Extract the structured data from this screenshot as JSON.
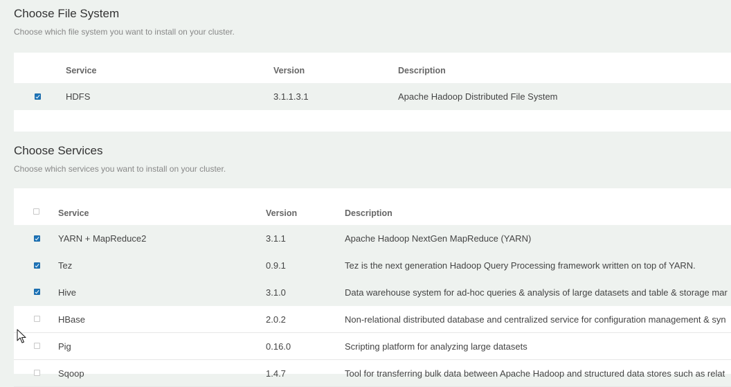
{
  "file_system": {
    "title": "Choose File System",
    "subtitle": "Choose which file system you want to install on your cluster.",
    "columns": {
      "service": "Service",
      "version": "Version",
      "description": "Description"
    },
    "rows": [
      {
        "checked": true,
        "service": "HDFS",
        "version": "3.1.1.3.1",
        "description": "Apache Hadoop Distributed File System"
      }
    ]
  },
  "services": {
    "title": "Choose Services",
    "subtitle": "Choose which services you want to install on your cluster.",
    "columns": {
      "service": "Service",
      "version": "Version",
      "description": "Description"
    },
    "select_all_checked": false,
    "rows": [
      {
        "checked": true,
        "service": "YARN + MapReduce2",
        "version": "3.1.1",
        "description": "Apache Hadoop NextGen MapReduce (YARN)"
      },
      {
        "checked": true,
        "service": "Tez",
        "version": "0.9.1",
        "description": "Tez is the next generation Hadoop Query Processing framework written on top of YARN."
      },
      {
        "checked": true,
        "service": "Hive",
        "version": "3.1.0",
        "description": "Data warehouse system for ad-hoc queries & analysis of large datasets and table & storage mar"
      },
      {
        "checked": false,
        "service": "HBase",
        "version": "2.0.2",
        "description": "Non-relational distributed database and centralized service for configuration management & syn"
      },
      {
        "checked": false,
        "service": "Pig",
        "version": "0.16.0",
        "description": "Scripting platform for analyzing large datasets"
      },
      {
        "checked": false,
        "service": "Sqoop",
        "version": "1.4.7",
        "description": "Tool for transferring bulk data between Apache Hadoop and structured data stores such as relat"
      }
    ]
  },
  "colors": {
    "background": "#eef2ef",
    "panel": "#ffffff",
    "checkbox_on": "#1d74b8",
    "selected_row": "#eef2ef"
  },
  "icons": {
    "cursor": "mouse-pointer-icon"
  }
}
